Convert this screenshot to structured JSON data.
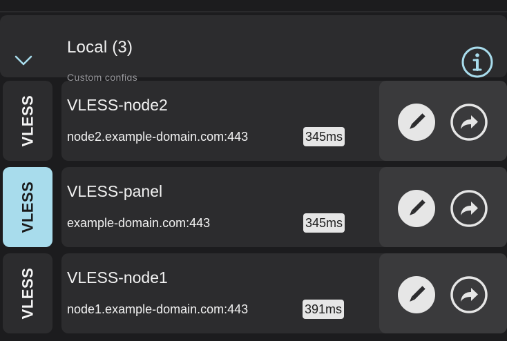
{
  "group": {
    "title": "Local (3)",
    "subtitle": "Custom configs",
    "toggle_icon": "chevron-down-icon",
    "info_icon": "info-icon"
  },
  "colors": {
    "accent": "#a8dcec",
    "background": "#1c1c1e",
    "card": "#2c2c2e",
    "action_panel": "#3a3a3c",
    "latency_badge": "#e6e6e6"
  },
  "configs": [
    {
      "protocol": "VLESS",
      "name": "VLESS-node2",
      "address": "node2.example-domain.com:443",
      "latency": "345ms",
      "selected": false,
      "edit_icon": "pencil-icon",
      "share_icon": "share-arrow-icon"
    },
    {
      "protocol": "VLESS",
      "name": "VLESS-panel",
      "address": "example-domain.com:443",
      "latency": "345ms",
      "selected": true,
      "edit_icon": "pencil-icon",
      "share_icon": "share-arrow-icon"
    },
    {
      "protocol": "VLESS",
      "name": "VLESS-node1",
      "address": "node1.example-domain.com:443",
      "latency": "391ms",
      "selected": false,
      "edit_icon": "pencil-icon",
      "share_icon": "share-arrow-icon"
    }
  ]
}
